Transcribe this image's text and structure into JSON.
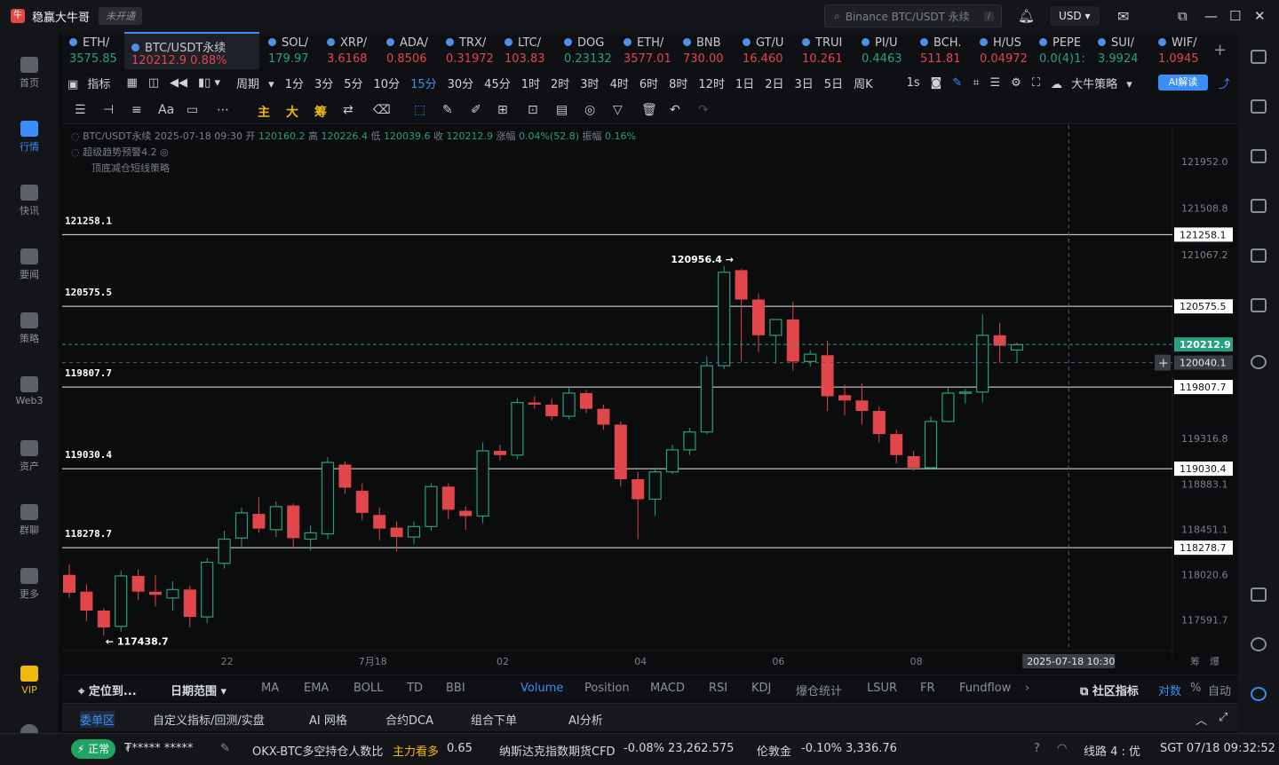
{
  "app": {
    "name": "稳赢大牛哥",
    "badge": "未开通"
  },
  "topbar": {
    "search_placeholder": "Binance BTC/USDT 永续",
    "search_shortcut": "/",
    "currency": "USD"
  },
  "left_nav": [
    {
      "label": "首页"
    },
    {
      "label": "行情",
      "active": true
    },
    {
      "label": "快讯"
    },
    {
      "label": "要闻"
    },
    {
      "label": "策略"
    },
    {
      "label": "Web3"
    },
    {
      "label": "资产"
    },
    {
      "label": "群聊"
    },
    {
      "label": "更多"
    },
    {
      "label": "VIP"
    }
  ],
  "tickers": [
    {
      "sym": "ETH/",
      "px": "3575.85",
      "dir": "up"
    },
    {
      "sym": "BTC/USDT永续",
      "px": "120212.9  0.88%",
      "dir": "dn",
      "active": true
    },
    {
      "sym": "SOL/",
      "px": "179.97",
      "dir": "up"
    },
    {
      "sym": "XRP/",
      "px": "3.6168",
      "dir": "dn"
    },
    {
      "sym": "ADA/",
      "px": "0.8506",
      "dir": "dn"
    },
    {
      "sym": "TRX/",
      "px": "0.31972",
      "dir": "dn"
    },
    {
      "sym": "LTC/",
      "px": "103.83",
      "dir": "dn"
    },
    {
      "sym": "DOG",
      "px": "0.23132",
      "dir": "up"
    },
    {
      "sym": "ETH/",
      "px": "3577.01",
      "dir": "dn"
    },
    {
      "sym": "BNB",
      "px": "730.00",
      "dir": "dn"
    },
    {
      "sym": "GT/U",
      "px": "16.460",
      "dir": "dn"
    },
    {
      "sym": "TRUI",
      "px": "10.261",
      "dir": "dn"
    },
    {
      "sym": "PI/U",
      "px": "0.4463",
      "dir": "up"
    },
    {
      "sym": "BCH.",
      "px": "511.81",
      "dir": "dn"
    },
    {
      "sym": "H/US",
      "px": "0.04972",
      "dir": "dn"
    },
    {
      "sym": "PEPE",
      "px": "0.0(4)1:",
      "dir": "up"
    },
    {
      "sym": "SUI/",
      "px": "3.9924",
      "dir": "up"
    },
    {
      "sym": "WIF/",
      "px": "1.0945",
      "dir": "dn"
    }
  ],
  "intervals": {
    "indicator_label": "指标",
    "period_label": "周期",
    "items": [
      "1分",
      "3分",
      "5分",
      "10分",
      "15分",
      "30分",
      "45分",
      "1时",
      "2时",
      "3时",
      "4时",
      "6时",
      "8时",
      "12时",
      "1日",
      "2日",
      "3日",
      "5日",
      "周K"
    ],
    "selected": "15分",
    "tick_label": "1s",
    "strategy_label": "大牛策略",
    "ai_label": "AI解读"
  },
  "drawtools": {
    "main": "主",
    "big": "大",
    "chip": "筹",
    "font": "Aa"
  },
  "chart_meta": {
    "symbol": "BTC/USDT永续",
    "datetime": "2025-07-18 09:30",
    "open_label": "开",
    "open": "120160.2",
    "high_label": "高",
    "high": "120226.4",
    "low_label": "低",
    "low": "120039.6",
    "close_label": "收",
    "close": "120212.9",
    "change_label": "涨幅",
    "change": "0.04%(52.8)",
    "amp_label": "振幅",
    "amp": "0.16%",
    "indicator1": "超级趋势预警4.2",
    "indicator2": "顶底减仓短线策略"
  },
  "chart_data": {
    "type": "candlestick",
    "interval": "15分",
    "ylim": [
      117300,
      122300
    ],
    "y_ticks": [
      121952.0,
      121508.8,
      121067.2,
      120626.0,
      120193.4,
      119316.8,
      118883.1,
      118451.1,
      118020.6,
      117591.7
    ],
    "y_tick_labels": [
      "121952.0",
      "121508.8",
      "121067.2",
      "",
      "",
      "119316.8",
      "118883.1",
      "118451.1",
      "118020.6",
      "117591.7"
    ],
    "x_labels": [
      "22",
      "7月18",
      "02",
      "04",
      "06",
      "08"
    ],
    "x_label_index": [
      9,
      17,
      25,
      33,
      41,
      49
    ],
    "horizontal_levels": [
      {
        "value": 121258.1,
        "label": "121258.1"
      },
      {
        "value": 120575.5,
        "label": "120575.5"
      },
      {
        "value": 119807.7,
        "label": "119807.7"
      },
      {
        "value": 119030.4,
        "label": "119030.4"
      },
      {
        "value": 118278.7,
        "label": "118278.7"
      }
    ],
    "last_price": {
      "value": 120212.9,
      "label": "120212.9"
    },
    "crosshair_price": {
      "value": 120040.1,
      "label": "120040.1"
    },
    "crosshair_time": "2025-07-18 10:30",
    "crosshair_index": 58,
    "annotations": [
      {
        "label": "120956.4",
        "value": 120956.4,
        "index": 38
      },
      {
        "label": "117438.7",
        "value": 117438.7,
        "index": 2
      }
    ],
    "candles": [
      {
        "o": 118020,
        "h": 118120,
        "l": 117800,
        "c": 117850
      },
      {
        "o": 117860,
        "h": 117930,
        "l": 117580,
        "c": 117680
      },
      {
        "o": 117680,
        "h": 117700,
        "l": 117440,
        "c": 117520
      },
      {
        "o": 117530,
        "h": 118060,
        "l": 117480,
        "c": 118010
      },
      {
        "o": 118010,
        "h": 118070,
        "l": 117780,
        "c": 117860
      },
      {
        "o": 117860,
        "h": 118020,
        "l": 117720,
        "c": 117830
      },
      {
        "o": 117800,
        "h": 117960,
        "l": 117680,
        "c": 117880
      },
      {
        "o": 117880,
        "h": 117920,
        "l": 117520,
        "c": 117620
      },
      {
        "o": 117620,
        "h": 118180,
        "l": 117560,
        "c": 118140
      },
      {
        "o": 118130,
        "h": 118440,
        "l": 118080,
        "c": 118360
      },
      {
        "o": 118370,
        "h": 118660,
        "l": 118290,
        "c": 118610
      },
      {
        "o": 118600,
        "h": 118760,
        "l": 118420,
        "c": 118460
      },
      {
        "o": 118450,
        "h": 118720,
        "l": 118380,
        "c": 118670
      },
      {
        "o": 118680,
        "h": 118700,
        "l": 118290,
        "c": 118370
      },
      {
        "o": 118360,
        "h": 118490,
        "l": 118250,
        "c": 118420
      },
      {
        "o": 118410,
        "h": 119140,
        "l": 118360,
        "c": 119090
      },
      {
        "o": 119070,
        "h": 119100,
        "l": 118790,
        "c": 118850
      },
      {
        "o": 118820,
        "h": 118890,
        "l": 118540,
        "c": 118610
      },
      {
        "o": 118590,
        "h": 118660,
        "l": 118350,
        "c": 118460
      },
      {
        "o": 118470,
        "h": 118530,
        "l": 118240,
        "c": 118380
      },
      {
        "o": 118380,
        "h": 118530,
        "l": 118310,
        "c": 118480
      },
      {
        "o": 118480,
        "h": 118890,
        "l": 118440,
        "c": 118860
      },
      {
        "o": 118860,
        "h": 118890,
        "l": 118550,
        "c": 118640
      },
      {
        "o": 118630,
        "h": 118670,
        "l": 118450,
        "c": 118580
      },
      {
        "o": 118580,
        "h": 119280,
        "l": 118510,
        "c": 119200
      },
      {
        "o": 119200,
        "h": 119260,
        "l": 119110,
        "c": 119160
      },
      {
        "o": 119160,
        "h": 119700,
        "l": 119120,
        "c": 119660
      },
      {
        "o": 119660,
        "h": 119720,
        "l": 119600,
        "c": 119640
      },
      {
        "o": 119640,
        "h": 119700,
        "l": 119490,
        "c": 119530
      },
      {
        "o": 119530,
        "h": 119800,
        "l": 119500,
        "c": 119750
      },
      {
        "o": 119750,
        "h": 119780,
        "l": 119560,
        "c": 119600
      },
      {
        "o": 119600,
        "h": 119640,
        "l": 119400,
        "c": 119450
      },
      {
        "o": 119450,
        "h": 119480,
        "l": 118860,
        "c": 118930
      },
      {
        "o": 118930,
        "h": 119000,
        "l": 118360,
        "c": 118740
      },
      {
        "o": 118740,
        "h": 119040,
        "l": 118580,
        "c": 119000
      },
      {
        "o": 119000,
        "h": 119260,
        "l": 118980,
        "c": 119210
      },
      {
        "o": 119210,
        "h": 119420,
        "l": 119160,
        "c": 119380
      },
      {
        "o": 119380,
        "h": 120100,
        "l": 119360,
        "c": 120010
      },
      {
        "o": 120010,
        "h": 120960,
        "l": 119980,
        "c": 120900
      },
      {
        "o": 120920,
        "h": 120930,
        "l": 120050,
        "c": 120640
      },
      {
        "o": 120640,
        "h": 120700,
        "l": 120140,
        "c": 120300
      },
      {
        "o": 120300,
        "h": 120400,
        "l": 120030,
        "c": 120450
      },
      {
        "o": 120450,
        "h": 120620,
        "l": 119960,
        "c": 120050
      },
      {
        "o": 120050,
        "h": 120160,
        "l": 120000,
        "c": 120120
      },
      {
        "o": 120110,
        "h": 120250,
        "l": 119580,
        "c": 119720
      },
      {
        "o": 119730,
        "h": 119830,
        "l": 119540,
        "c": 119680
      },
      {
        "o": 119680,
        "h": 119840,
        "l": 119450,
        "c": 119580
      },
      {
        "o": 119580,
        "h": 119620,
        "l": 119280,
        "c": 119360
      },
      {
        "o": 119360,
        "h": 119400,
        "l": 119080,
        "c": 119160
      },
      {
        "o": 119150,
        "h": 119200,
        "l": 119010,
        "c": 119040
      },
      {
        "o": 119040,
        "h": 119530,
        "l": 119020,
        "c": 119480
      },
      {
        "o": 119480,
        "h": 119800,
        "l": 119470,
        "c": 119750
      },
      {
        "o": 119750,
        "h": 119790,
        "l": 119650,
        "c": 119760
      },
      {
        "o": 119760,
        "h": 120500,
        "l": 119660,
        "c": 120300
      },
      {
        "o": 120300,
        "h": 120420,
        "l": 120040,
        "c": 120200
      },
      {
        "o": 120160,
        "h": 120230,
        "l": 120040,
        "c": 120210
      }
    ]
  },
  "indicator_tabs": {
    "locate": "定位到...",
    "date_range": "日期范围",
    "items": [
      "MA",
      "EMA",
      "BOLL",
      "TD",
      "BBI",
      "Volume",
      "Position",
      "MACD",
      "RSI",
      "KDJ",
      "爆仓统计",
      "LSUR",
      "FR",
      "Fundflow"
    ],
    "selected": "Volume",
    "community": "社区指标",
    "log": "对数",
    "pct": "%",
    "auto": "自动"
  },
  "order_tabs": [
    "委单区",
    "自定义指标/回测/实盘",
    "AI 网格",
    "合约DCA",
    "组合下单",
    "AI分析"
  ],
  "order_tab_selected": "委单区",
  "statusbar": {
    "status": "正常",
    "user": "₮*****  *****",
    "item1_name": "OKX-BTC多空持仓人数比",
    "item1_tag": "主力看多",
    "item1_val": "0.65",
    "item2_name": "纳斯达克指数期货CFD",
    "item2_chg": "-0.08%",
    "item2_val": "23,262.575",
    "item3_name": "伦敦金",
    "item3_chg": "-0.10%",
    "item3_val": "3,336.76",
    "line": "线路 4 : 优",
    "clock": "SGT 07/18 09:32:52"
  },
  "colors": {
    "up": "#26a17b",
    "down": "#e0464a",
    "accent": "#3b8df7",
    "gold": "#f0b90b"
  }
}
